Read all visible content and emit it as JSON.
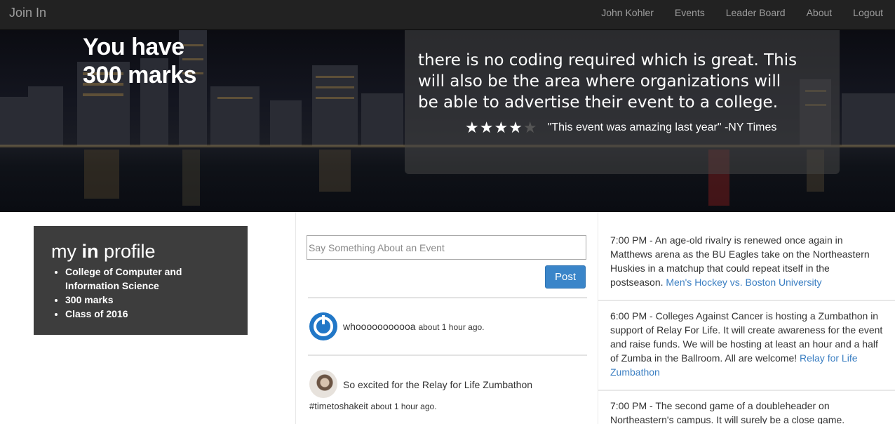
{
  "nav": {
    "brand": "Join In",
    "links": [
      "John Kohler",
      "Events",
      "Leader Board",
      "About",
      "Logout"
    ]
  },
  "hero": {
    "marks_line1": "You have",
    "marks_line2": "300 marks",
    "quote_lines": [
      "there is no coding required which is great. This",
      "will also be the area where organizations will",
      "be able to advertise their event to a college."
    ],
    "rating": {
      "value": 4,
      "max": 5
    },
    "stars_on": "★★★★",
    "stars_off": "★",
    "review": "\"This event was amazing last year\" -NY Times"
  },
  "profile": {
    "title_plain1": "my",
    "title_bold": "in",
    "title_plain2": "profile",
    "items": [
      "College of Computer and Information Science",
      "300 marks",
      "Class of 2016"
    ]
  },
  "feed": {
    "placeholder": "Say Something About an Event",
    "post_label": "Post",
    "posts": [
      {
        "user": "whooooooooooa",
        "text": "",
        "time": "about 1 hour ago."
      },
      {
        "user": "",
        "text": "So excited for the Relay for Life Zumbathon",
        "text2": "#timetoshakeit",
        "time": "about 1 hour ago."
      }
    ]
  },
  "events": [
    {
      "text": "7:00 PM - An age-old rivalry is renewed once again in Matthews arena as the BU Eagles take on the Northeastern Huskies in a matchup that could repeat itself in the postseason.",
      "link": "Men's Hockey vs. Boston University"
    },
    {
      "text": "6:00 PM - Colleges Against Cancer is hosting a Zumbathon in support of Relay For Life. It will create awareness for the event and raise funds. We will be hosting at least an hour and a half of Zumba in the Ballroom. All are welcome!",
      "link": "Relay for Life Zumbathon"
    },
    {
      "text": "7:00 PM - The second game of a doubleheader on Northeastern's campus. It will surely be a close game.",
      "link": ""
    }
  ]
}
